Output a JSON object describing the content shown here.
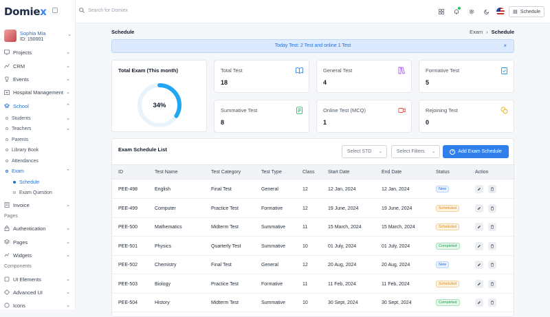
{
  "brand": {
    "name_main": "Domie",
    "name_accent": "x"
  },
  "profile": {
    "name": "Sophia Mia",
    "id": "ID: 150001"
  },
  "sidebar": {
    "items": [
      {
        "label": "Projects",
        "icon": "monitor-icon"
      },
      {
        "label": "CRM",
        "icon": "chart-icon"
      },
      {
        "label": "Events",
        "icon": "trophy-icon"
      },
      {
        "label": "Hospital Management",
        "icon": "hospital-icon"
      },
      {
        "label": "School",
        "icon": "school-icon"
      }
    ],
    "school_sub": [
      "Students",
      "Teachers",
      "Parents",
      "Library Book",
      "Attendances",
      "Exam"
    ],
    "exam_sub": [
      "Schedule",
      "Exam Question"
    ],
    "invoice": "Invoice",
    "pages_section": "Pages",
    "pages_items": [
      "Authentication",
      "Pages",
      "Widgets"
    ],
    "components_section": "Components",
    "components_items": [
      "UI Elements",
      "Advanced UI",
      "Icons"
    ]
  },
  "topbar": {
    "search_placeholder": "Search for Domiex",
    "schedule_btn": "Schedule"
  },
  "page": {
    "title": "Schedule",
    "breadcrumb_parent": "Exam",
    "breadcrumb_sep": "›",
    "breadcrumb_current": "Schedule"
  },
  "alert": {
    "text": "Today Test: 2 Test and online 1 Test",
    "close": "×"
  },
  "total_exam": {
    "title": "Total Exam (This month)",
    "percent_label": "34%",
    "percent": 34
  },
  "stats": [
    {
      "label": "Total Test",
      "value": "18",
      "color": "#2f80ed"
    },
    {
      "label": "General Test",
      "value": "4",
      "color": "#a855f7"
    },
    {
      "label": "Formative Test",
      "value": "5",
      "color": "#0ea5e9"
    },
    {
      "label": "Summative Test",
      "value": "8",
      "color": "#22c55e"
    },
    {
      "label": "Online Test (MCQ)",
      "value": "1",
      "color": "#ef4444"
    },
    {
      "label": "Rejoining Test",
      "value": "0",
      "color": "#eab308"
    }
  ],
  "table": {
    "title": "Exam Schedule List",
    "select_std": "Select STD",
    "select_filters": "Select Filters",
    "add_button": "Add Exam Schedule",
    "headers": [
      "ID",
      "Test Name",
      "Test Category",
      "Test Type",
      "Class",
      "Start Date",
      "End Date",
      "Status",
      "Action"
    ],
    "rows": [
      [
        "PEE-498",
        "English",
        "Final Test",
        "General",
        "12",
        "12 Jan, 2024",
        "12 Jan, 2024",
        "New"
      ],
      [
        "PEE-499",
        "Computer",
        "Practice Test",
        "Formative",
        "12",
        "19 June, 2024",
        "19 June, 2024",
        "Scheduled"
      ],
      [
        "PEE-500",
        "Mathematics",
        "Midterm Test",
        "Summative",
        "11",
        "15 March, 2024",
        "15 March, 2024",
        "Scheduled"
      ],
      [
        "PEE-501",
        "Physics",
        "Quarterly Test",
        "Summative",
        "10",
        "01 July, 2024",
        "01 July, 2024",
        "Completed"
      ],
      [
        "PEE-502",
        "Chemistry",
        "Final Test",
        "General",
        "12",
        "20 Aug, 2024",
        "20 Aug, 2024",
        "New"
      ],
      [
        "PEE-503",
        "Biology",
        "Practice Test",
        "Formative",
        "11",
        "11 Feb, 2024",
        "11 Feb, 2024",
        "Scheduled"
      ],
      [
        "PEE-504",
        "History",
        "Midterm Test",
        "Summative",
        "10",
        "30 Sept, 2024",
        "30 Sept, 2024",
        "Completed"
      ]
    ]
  }
}
